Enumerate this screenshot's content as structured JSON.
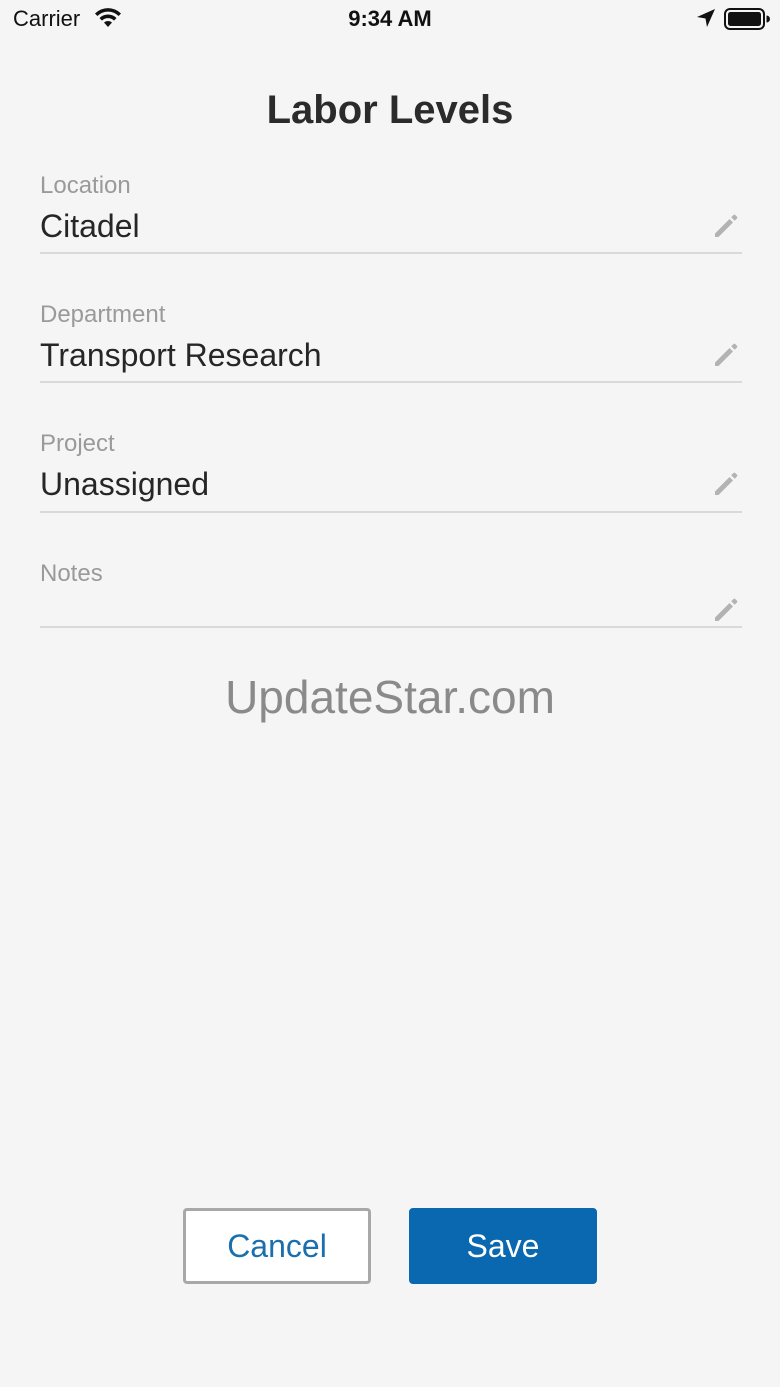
{
  "status_bar": {
    "carrier": "Carrier",
    "time": "9:34 AM",
    "icons": [
      "wifi-icon",
      "location-arrow-icon",
      "battery-icon"
    ]
  },
  "header": {
    "title": "Labor Levels"
  },
  "form": {
    "fields": [
      {
        "label": "Location",
        "value": "Citadel",
        "icon": "pencil-icon"
      },
      {
        "label": "Department",
        "value": "Transport Research",
        "icon": "pencil-icon"
      },
      {
        "label": "Project",
        "value": "Unassigned",
        "icon": "pencil-icon"
      },
      {
        "label": "Notes",
        "value": "",
        "icon": "pencil-icon"
      }
    ]
  },
  "watermark": "UpdateStar.com",
  "actions": {
    "cancel_label": "Cancel",
    "save_label": "Save"
  },
  "colors": {
    "background": "#f5f5f5",
    "primary": "#0a68b0",
    "label": "#9a9a9a",
    "divider": "#d9d9d9"
  }
}
